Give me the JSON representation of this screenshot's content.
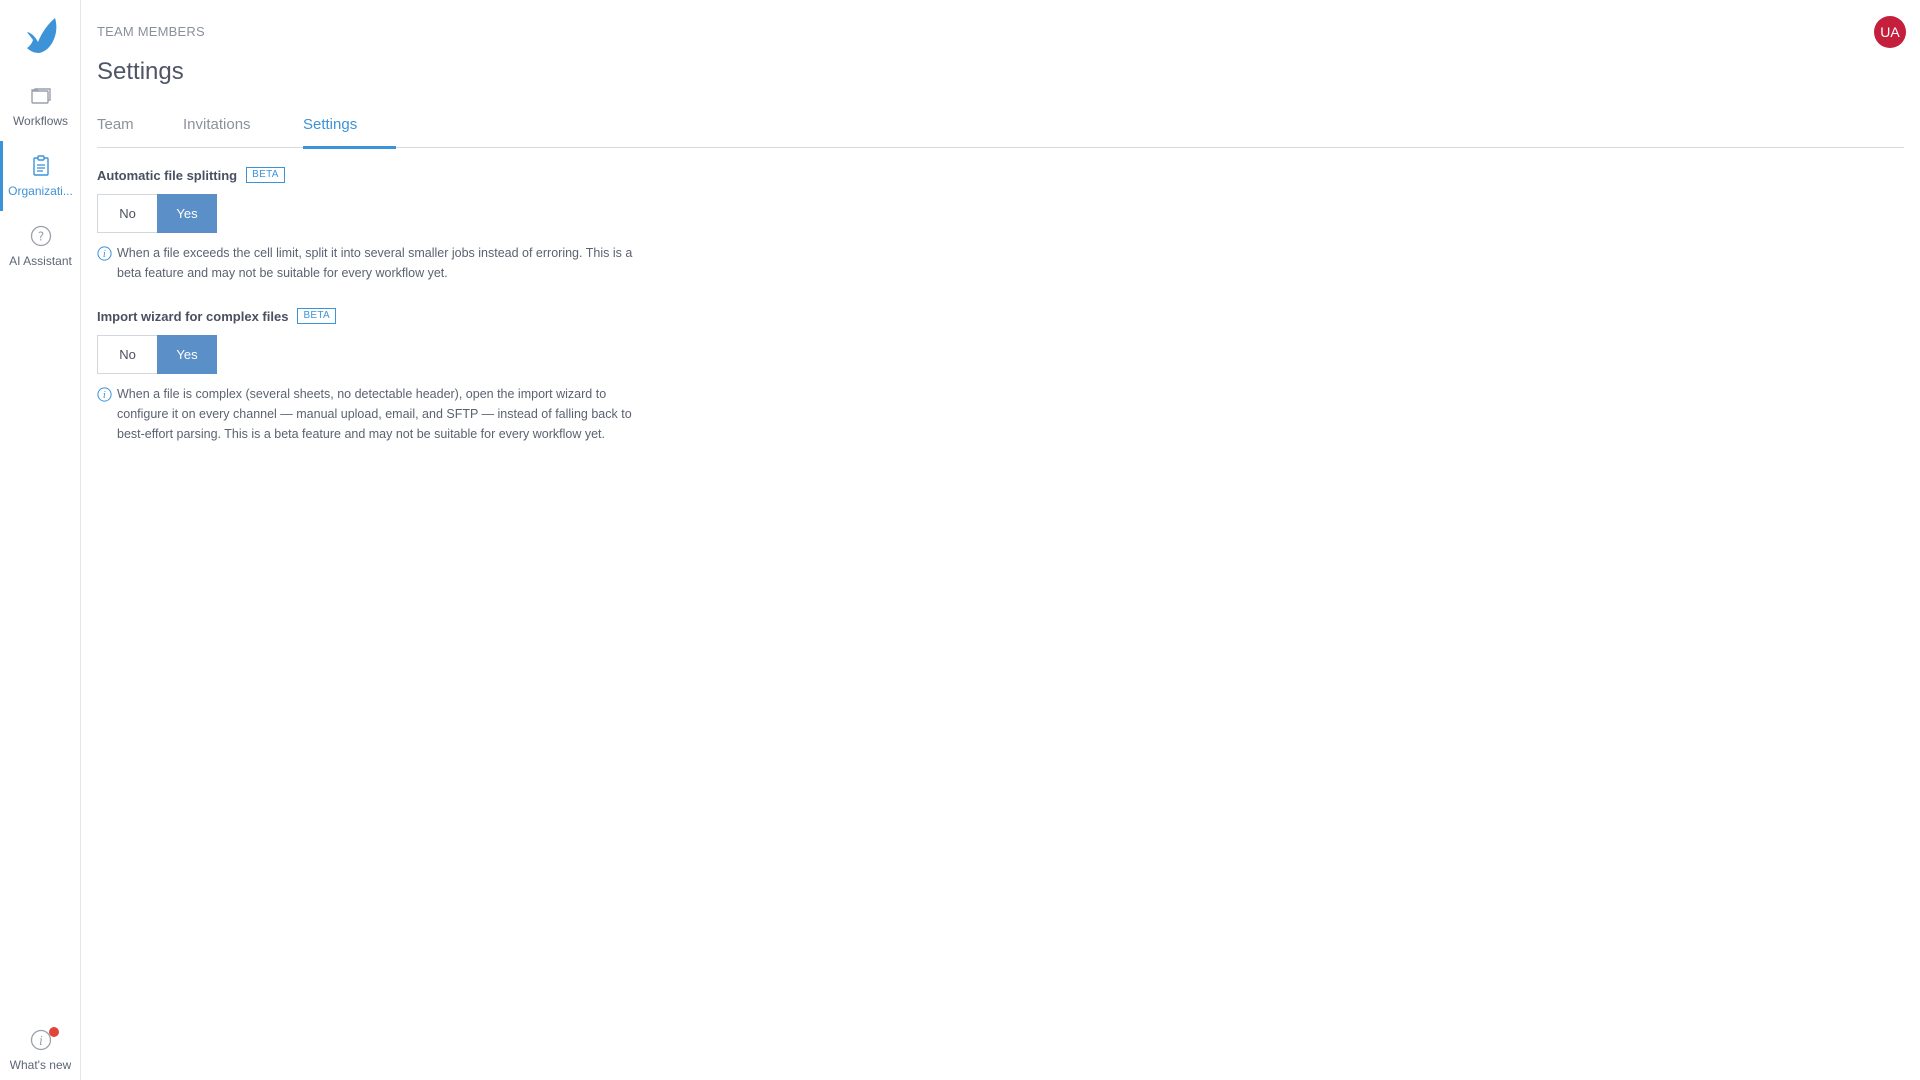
{
  "sidebar": {
    "items": [
      {
        "label": "Workflows",
        "icon": "folder-icon"
      },
      {
        "label": "Organizati...",
        "icon": "clipboard-icon"
      },
      {
        "label": "AI Assistant",
        "icon": "question-icon"
      }
    ],
    "footer": {
      "label": "What's new",
      "icon": "info-icon"
    }
  },
  "header": {
    "eyebrow": "TEAM MEMBERS",
    "title": "Settings",
    "avatar_initials": "UA"
  },
  "tabs": [
    {
      "label": "Team"
    },
    {
      "label": "Invitations"
    },
    {
      "label": "Settings"
    }
  ],
  "settings": [
    {
      "title": "Automatic file splitting",
      "badge": "BETA",
      "options": [
        "No",
        "Yes"
      ],
      "selected": "Yes",
      "help": "When a file exceeds the cell limit, split it into several smaller jobs instead of erroring. This is a beta feature and may not be suitable for every workflow yet."
    },
    {
      "title": "Import wizard for complex files",
      "badge": "BETA",
      "options": [
        "No",
        "Yes"
      ],
      "selected": "Yes",
      "help": "When a file is complex (several sheets, no detectable header), open the import wizard to configure it on every channel — manual upload, email, and SFTP — instead of falling back to best-effort parsing. This is a beta feature and may not be suitable for every workflow yet."
    }
  ],
  "colors": {
    "accent": "#3d93d8",
    "selected_toggle": "#5b8fc7",
    "avatar": "#c4203e",
    "notification_dot": "#e0453a"
  }
}
